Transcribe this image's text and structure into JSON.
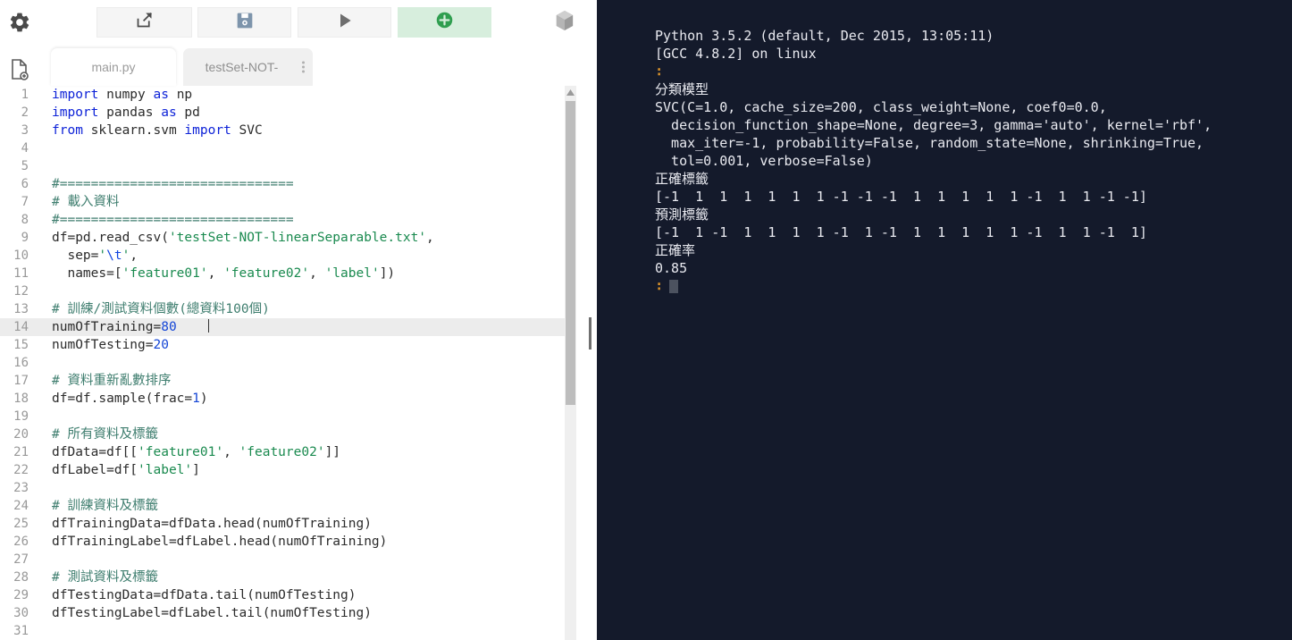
{
  "toolbar": {
    "gear_icon": "gear-icon",
    "newfile_icon": "new-file-icon",
    "share_icon": "share-export-icon",
    "save_icon": "save-floppy-icon",
    "run_icon": "run-play-icon",
    "add_icon": "add-circle-plus-icon",
    "package_icon": "package-box-icon",
    "accent_green": "#d7eedd",
    "accent_green_fg": "#2f9e4f"
  },
  "tabs": [
    {
      "label": "main.py",
      "active": true
    },
    {
      "label": "testSet-NOT-",
      "active": false
    }
  ],
  "editor": {
    "active_line": 14,
    "cursor_col": 18,
    "lines": [
      {
        "n": "1",
        "tokens": [
          {
            "t": "import",
            "c": "kw"
          },
          {
            "t": " numpy ",
            "c": ""
          },
          {
            "t": "as",
            "c": "kw"
          },
          {
            "t": " np",
            "c": ""
          }
        ]
      },
      {
        "n": "2",
        "tokens": [
          {
            "t": "import",
            "c": "kw"
          },
          {
            "t": " pandas ",
            "c": ""
          },
          {
            "t": "as",
            "c": "kw"
          },
          {
            "t": " pd",
            "c": ""
          }
        ]
      },
      {
        "n": "3",
        "tokens": [
          {
            "t": "from",
            "c": "kw"
          },
          {
            "t": " sklearn.svm ",
            "c": ""
          },
          {
            "t": "import",
            "c": "kw"
          },
          {
            "t": " SVC",
            "c": ""
          }
        ]
      },
      {
        "n": "4",
        "tokens": []
      },
      {
        "n": "5",
        "tokens": []
      },
      {
        "n": "6",
        "tokens": [
          {
            "t": "#==============================",
            "c": "cmt"
          }
        ]
      },
      {
        "n": "7",
        "tokens": [
          {
            "t": "# 載入資料",
            "c": "cmt"
          }
        ]
      },
      {
        "n": "8",
        "tokens": [
          {
            "t": "#==============================",
            "c": "cmt"
          }
        ]
      },
      {
        "n": "9",
        "tokens": [
          {
            "t": "df=pd.read_csv(",
            "c": ""
          },
          {
            "t": "'testSet-NOT-linearSeparable.txt'",
            "c": "str"
          },
          {
            "t": ",",
            "c": ""
          }
        ]
      },
      {
        "n": "10",
        "tokens": [
          {
            "t": "  sep=",
            "c": ""
          },
          {
            "t": "'",
            "c": "str"
          },
          {
            "t": "\\t",
            "c": "esc"
          },
          {
            "t": "'",
            "c": "str"
          },
          {
            "t": ",",
            "c": ""
          }
        ]
      },
      {
        "n": "11",
        "tokens": [
          {
            "t": "  names=[",
            "c": ""
          },
          {
            "t": "'feature01'",
            "c": "str"
          },
          {
            "t": ", ",
            "c": ""
          },
          {
            "t": "'feature02'",
            "c": "str"
          },
          {
            "t": ", ",
            "c": ""
          },
          {
            "t": "'label'",
            "c": "str"
          },
          {
            "t": "])",
            "c": ""
          }
        ]
      },
      {
        "n": "12",
        "tokens": []
      },
      {
        "n": "13",
        "tokens": [
          {
            "t": "# 訓練/測試資料個數(總資料100個)",
            "c": "cmt"
          }
        ]
      },
      {
        "n": "14",
        "tokens": [
          {
            "t": "numOfTraining=",
            "c": ""
          },
          {
            "t": "80",
            "c": "num"
          }
        ]
      },
      {
        "n": "15",
        "tokens": [
          {
            "t": "numOfTesting=",
            "c": ""
          },
          {
            "t": "20",
            "c": "num"
          }
        ]
      },
      {
        "n": "16",
        "tokens": []
      },
      {
        "n": "17",
        "tokens": [
          {
            "t": "# 資料重新亂數排序",
            "c": "cmt"
          }
        ]
      },
      {
        "n": "18",
        "tokens": [
          {
            "t": "df=df.sample(frac=",
            "c": ""
          },
          {
            "t": "1",
            "c": "num"
          },
          {
            "t": ")",
            "c": ""
          }
        ]
      },
      {
        "n": "19",
        "tokens": []
      },
      {
        "n": "20",
        "tokens": [
          {
            "t": "# 所有資料及標籤",
            "c": "cmt"
          }
        ]
      },
      {
        "n": "21",
        "tokens": [
          {
            "t": "dfData=df[[",
            "c": ""
          },
          {
            "t": "'feature01'",
            "c": "str"
          },
          {
            "t": ", ",
            "c": ""
          },
          {
            "t": "'feature02'",
            "c": "str"
          },
          {
            "t": "]]",
            "c": ""
          }
        ]
      },
      {
        "n": "22",
        "tokens": [
          {
            "t": "dfLabel=df[",
            "c": ""
          },
          {
            "t": "'label'",
            "c": "str"
          },
          {
            "t": "]",
            "c": ""
          }
        ]
      },
      {
        "n": "23",
        "tokens": []
      },
      {
        "n": "24",
        "tokens": [
          {
            "t": "# 訓練資料及標籤",
            "c": "cmt"
          }
        ]
      },
      {
        "n": "25",
        "tokens": [
          {
            "t": "dfTrainingData=dfData.head(numOfTraining)",
            "c": ""
          }
        ]
      },
      {
        "n": "26",
        "tokens": [
          {
            "t": "dfTrainingLabel=dfLabel.head(numOfTraining)",
            "c": ""
          }
        ]
      },
      {
        "n": "27",
        "tokens": []
      },
      {
        "n": "28",
        "tokens": [
          {
            "t": "# 測試資料及標籤",
            "c": "cmt"
          }
        ]
      },
      {
        "n": "29",
        "tokens": [
          {
            "t": "dfTestingData=dfData.tail(numOfTesting)",
            "c": ""
          }
        ]
      },
      {
        "n": "30",
        "tokens": [
          {
            "t": "dfTestingLabel=dfLabel.tail(numOfTesting)",
            "c": ""
          }
        ]
      },
      {
        "n": "31",
        "tokens": []
      }
    ]
  },
  "terminal": {
    "background": "#141a2b",
    "foreground": "#e9eaf0",
    "prompt_color": "#d9922a",
    "lines": [
      {
        "text": "Python 3.5.2 (default, Dec 2015, 13:05:11)",
        "kind": "out"
      },
      {
        "text": "[GCC 4.8.2] on linux",
        "kind": "out"
      },
      {
        "text": "",
        "kind": "prompt"
      },
      {
        "text": "分類模型",
        "kind": "cjk"
      },
      {
        "text": "SVC(C=1.0, cache_size=200, class_weight=None, coef0=0.0,",
        "kind": "out"
      },
      {
        "text": "  decision_function_shape=None, degree=3, gamma='auto', kernel='rbf',",
        "kind": "out"
      },
      {
        "text": "  max_iter=-1, probability=False, random_state=None, shrinking=True,",
        "kind": "out"
      },
      {
        "text": "  tol=0.001, verbose=False)",
        "kind": "out"
      },
      {
        "text": "正確標籤",
        "kind": "cjk"
      },
      {
        "text": "[-1  1  1  1  1  1  1 -1 -1 -1  1  1  1  1  1 -1  1  1 -1 -1]",
        "kind": "out"
      },
      {
        "text": "預測標籤",
        "kind": "cjk"
      },
      {
        "text": "[-1  1 -1  1  1  1  1 -1  1 -1  1  1  1  1  1 -1  1  1 -1  1]",
        "kind": "out"
      },
      {
        "text": "正確率",
        "kind": "cjk"
      },
      {
        "text": "0.85",
        "kind": "out"
      },
      {
        "text": "",
        "kind": "cursor"
      }
    ],
    "true_labels": [
      -1,
      1,
      1,
      1,
      1,
      1,
      1,
      -1,
      -1,
      -1,
      1,
      1,
      1,
      1,
      1,
      -1,
      1,
      1,
      -1,
      -1
    ],
    "predicted_labels": [
      -1,
      1,
      -1,
      1,
      1,
      1,
      1,
      -1,
      1,
      -1,
      1,
      1,
      1,
      1,
      1,
      -1,
      1,
      1,
      -1,
      1
    ],
    "accuracy": "0.85"
  }
}
